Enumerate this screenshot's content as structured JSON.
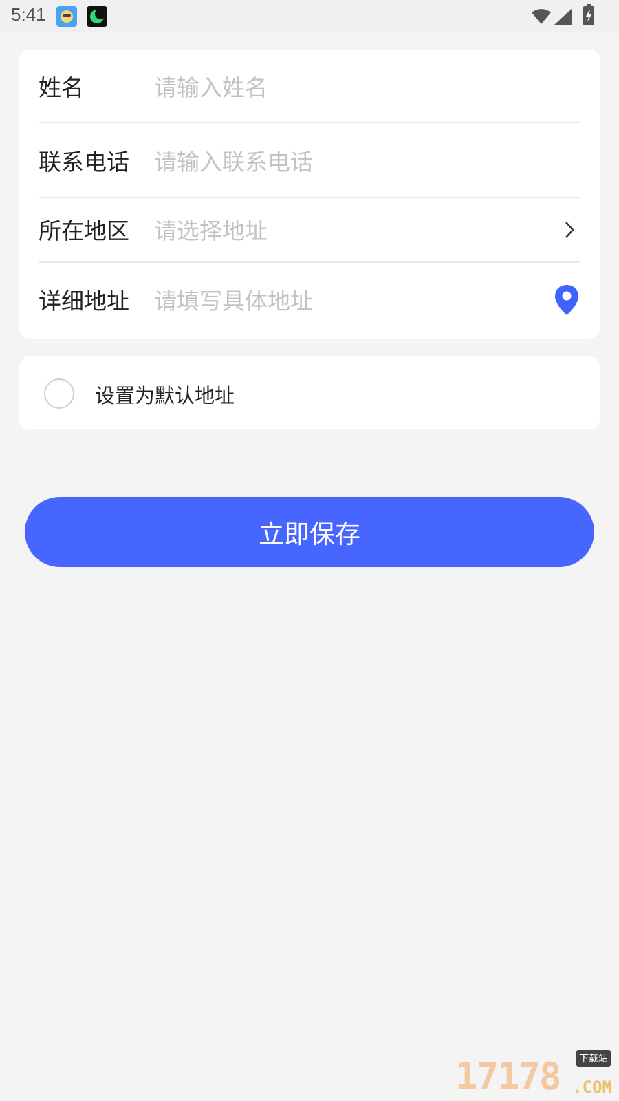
{
  "status_bar": {
    "time": "5:41",
    "icons": [
      "app-face-icon",
      "app-moon-icon",
      "wifi-icon",
      "signal-icon",
      "battery-charging-icon"
    ]
  },
  "form": {
    "name": {
      "label": "姓名",
      "placeholder": "请输入姓名"
    },
    "phone": {
      "label": "联系电话",
      "placeholder": "请输入联系电话"
    },
    "region": {
      "label": "所在地区",
      "placeholder": "请选择地址",
      "icon": "chevron-right-icon"
    },
    "detail": {
      "label": "详细地址",
      "placeholder": "请填写具体地址",
      "icon": "location-pin-icon"
    }
  },
  "default_address": {
    "label": "设置为默认地址",
    "checked": false
  },
  "save_button": {
    "label": "立即保存"
  },
  "watermark": {
    "numbers": "17178",
    "domain": ".COM",
    "tag": "下载站"
  },
  "colors": {
    "accent": "#4766ff",
    "pin": "#3f63ff",
    "placeholder": "#c2c2c2",
    "background": "#f4f4f5"
  }
}
